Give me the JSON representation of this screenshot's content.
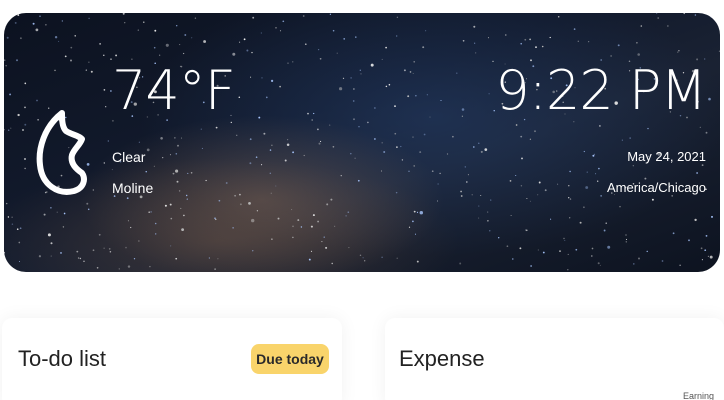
{
  "weather": {
    "temperature": "74°F",
    "condition": "Clear",
    "location": "Moline",
    "icon": "moon-icon"
  },
  "clock": {
    "time": "9:22 PM",
    "date": "May 24, 2021",
    "timezone": "America/Chicago"
  },
  "todo": {
    "title": "To-do list",
    "badge": "Due today"
  },
  "expense": {
    "title": "Expense",
    "legend_label": "Earning"
  },
  "colors": {
    "badge": "#f9d46b",
    "text": "#222222",
    "white": "#ffffff"
  }
}
